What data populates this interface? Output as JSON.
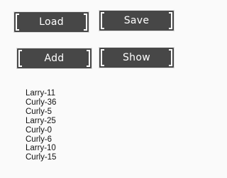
{
  "buttons": {
    "load": "Load",
    "save": "Save",
    "add": "Add",
    "show": "Show"
  },
  "results": [
    "Larry-11",
    "Curly-36",
    "Curly-5",
    "Larry-25",
    "Curly-0",
    "Curly-6",
    "Larry-10",
    "Curly-15"
  ],
  "colors": {
    "background": "#fafafa",
    "button_bg": "#474747",
    "button_text": "#ffffff",
    "text": "#111111"
  }
}
